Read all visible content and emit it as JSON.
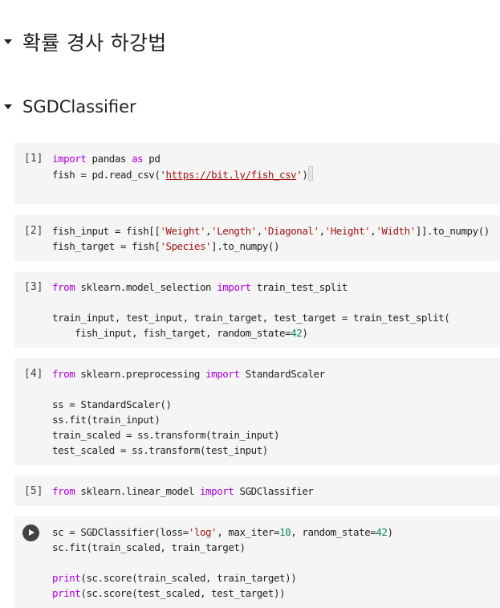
{
  "headings": {
    "h1": "확률 경사 하강법",
    "h2": "SGDClassifier"
  },
  "cells": {
    "c1": {
      "prompt": "[1]",
      "l1": {
        "a": "import",
        "b": " pandas ",
        "c": "as",
        "d": " pd"
      },
      "l2": {
        "a": "fish = pd.read_csv('",
        "b": "https://bit.ly/fish_csv",
        "c": "')"
      }
    },
    "c2": {
      "prompt": "[2]",
      "l1": {
        "a": "fish_input = fish[[",
        "s1": "'Weight'",
        "s2": "'Length'",
        "s3": "'Diagonal'",
        "s4": "'Height'",
        "s5": "'Width'",
        "comma": ",",
        "b": "]].to_numpy()"
      },
      "l2": {
        "a": "fish_target = fish[",
        "s": "'Species'",
        "b": "].to_numpy()"
      }
    },
    "c3": {
      "prompt": "[3]",
      "l1": {
        "kw1": "from",
        "a": " sklearn.model_selection ",
        "kw2": "import",
        "b": " train_test_split"
      },
      "l3": "train_input, test_input, train_target, test_target = train_test_split(",
      "l4": {
        "a": "    fish_input, fish_target, random_state=",
        "n": "42",
        "b": ")"
      }
    },
    "c4": {
      "prompt": "[4]",
      "l1": {
        "kw1": "from",
        "a": " sklearn.preprocessing ",
        "kw2": "import",
        "b": " StandardScaler"
      },
      "l3": "ss = StandardScaler()",
      "l4": "ss.fit(train_input)",
      "l5": "train_scaled = ss.transform(train_input)",
      "l6": "test_scaled = ss.transform(test_input)"
    },
    "c5": {
      "prompt": "[5]",
      "l1": {
        "kw1": "from",
        "a": " sklearn.linear_model ",
        "kw2": "import",
        "b": " SGDClassifier"
      }
    },
    "c6": {
      "l1": {
        "a": "sc = SGDClassifier(loss=",
        "s": "'log'",
        "b": ", max_iter=",
        "n1": "10",
        "c": ", random_state=",
        "n2": "42",
        "d": ")"
      },
      "l2": "sc.fit(train_scaled, train_target)",
      "l4": {
        "kw": "print",
        "a": "(sc.score(train_scaled, train_target))"
      },
      "l5": {
        "kw": "print",
        "a": "(sc.score(test_scaled, test_target))"
      }
    }
  }
}
